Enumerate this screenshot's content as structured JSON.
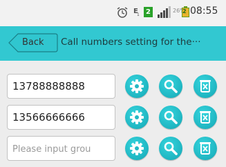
{
  "status_bar": {
    "sim_label": "E",
    "sim_sub": "1",
    "message_count": "2",
    "battery_percent": "26%",
    "battery_digit": "2",
    "time": "08:55"
  },
  "header": {
    "back_label": "Back",
    "title": "Call numbers setting for the···",
    "background_color": "#32c8d1"
  },
  "rows": [
    {
      "value": "13788888888",
      "placeholder": ""
    },
    {
      "value": "13566666666",
      "placeholder": ""
    },
    {
      "value": "",
      "placeholder": "Please input grou"
    }
  ],
  "row_icons": [
    "settings-gear-icon",
    "search-icon",
    "delete-trash-icon"
  ]
}
